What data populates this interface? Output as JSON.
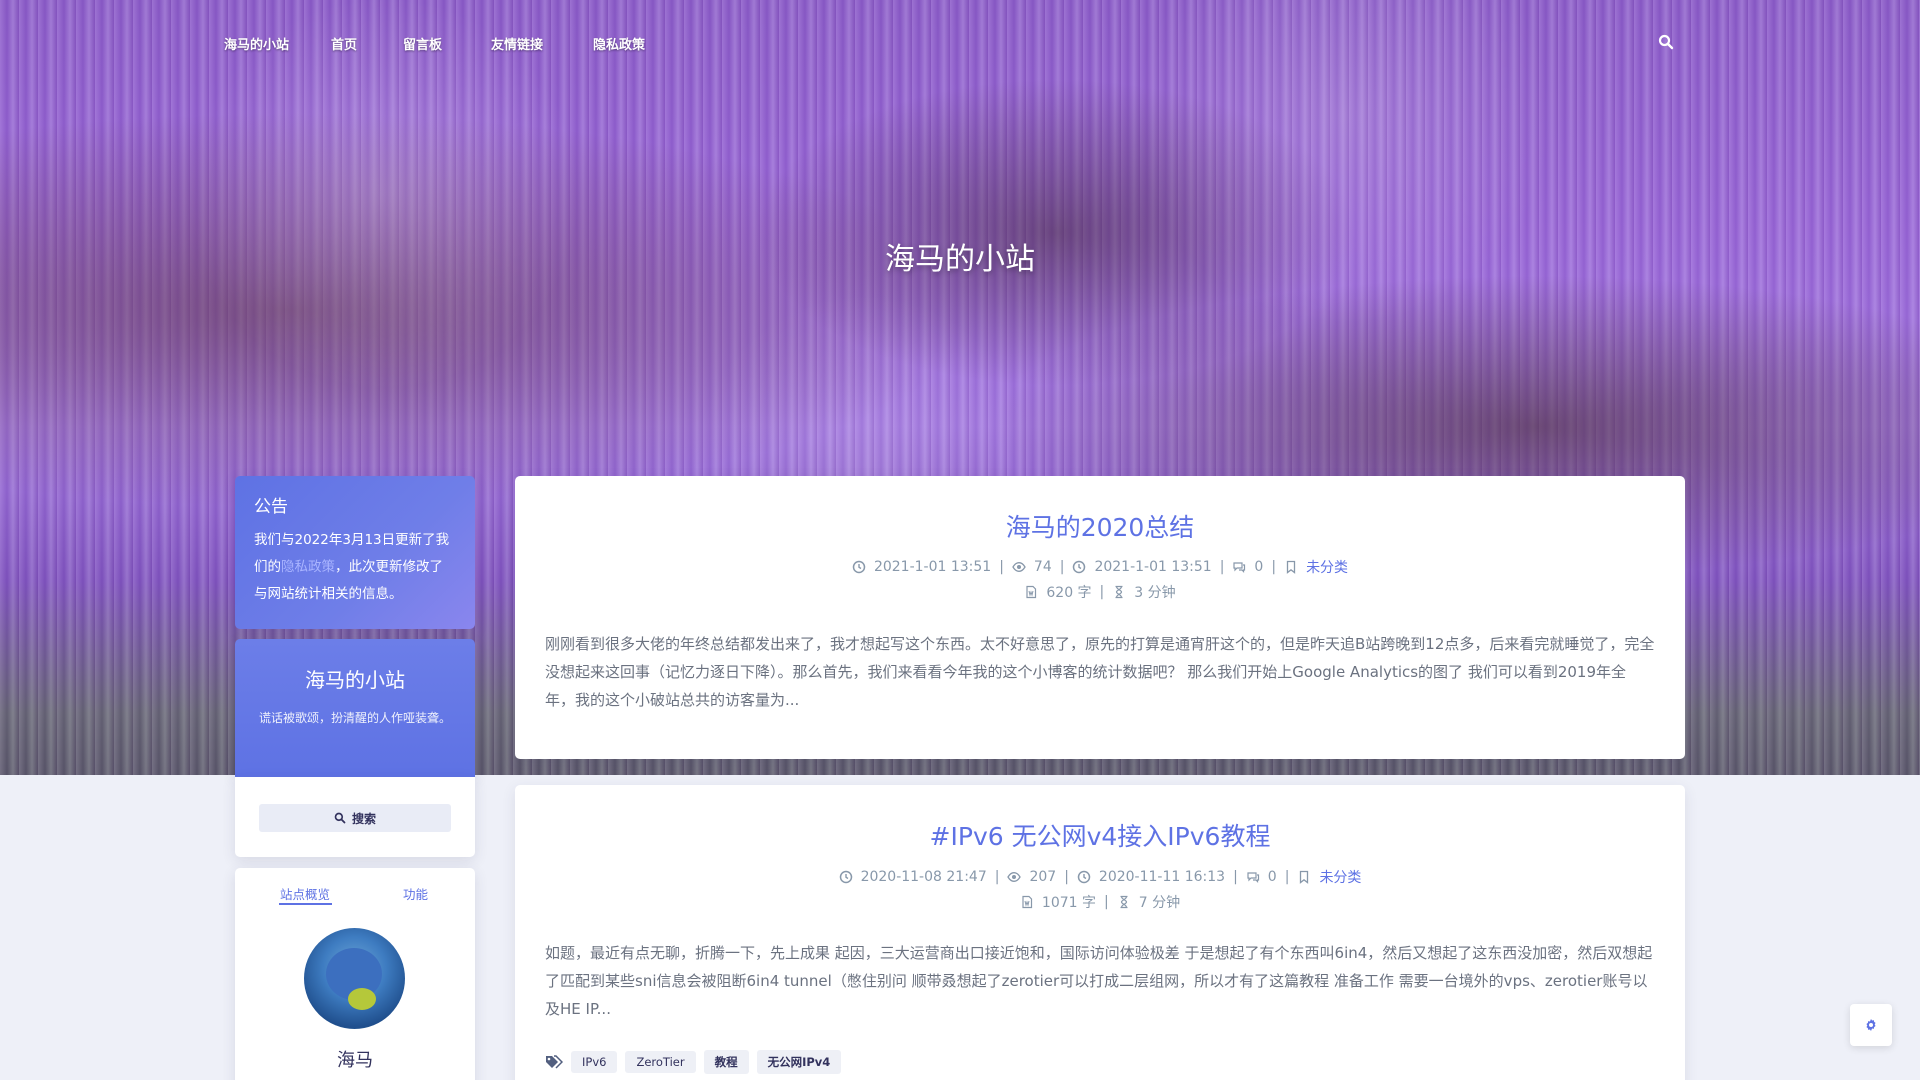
{
  "nav": {
    "brand": "海马的小站",
    "items": [
      {
        "label": "首页"
      },
      {
        "label": "留言板"
      },
      {
        "label": "友情链接"
      },
      {
        "label": "隐私政策"
      }
    ],
    "search_icon": "search-icon"
  },
  "hero": {
    "title": "海马的小站"
  },
  "sidebar": {
    "notice": {
      "title": "公告",
      "text_before": "我们与2022年3月13日更新了我们的",
      "link": "隐私政策",
      "text_after": "，此次更新修改了与网站统计相关的信息。"
    },
    "site": {
      "title": "海马的小站",
      "subtitle": "谎话被歌颂，扮清醒的人作哑装聋。"
    },
    "search": {
      "label": "搜索",
      "icon": "search-icon"
    },
    "overview": {
      "tabs": [
        {
          "label": "站点概览"
        },
        {
          "label": "功能"
        }
      ],
      "author_name": "海马"
    }
  },
  "posts": [
    {
      "title": "海马的2020总结",
      "published": "2021-1-01 13:51",
      "views": "74",
      "updated": "2021-1-01 13:51",
      "comments": "0",
      "category": "未分类",
      "words": "620 字",
      "read_time": "3 分钟",
      "excerpt": "刚刚看到很多大佬的年终总结都发出来了，我才想起写这个东西。太不好意思了，原先的打算是通宵肝这个的，但是昨天追B站跨晚到12点多，后来看完就睡觉了，完全没想起来这回事（记忆力逐日下降）。那么首先，我们来看看今年我的这个小博客的统计数据吧？ 那么我们开始上Google Analytics的图了 我们可以看到2019年全年，我的这个小破站总共的访客量为..."
    },
    {
      "title": "#IPv6 无公网v4接入IPv6教程",
      "published": "2020-11-08 21:47",
      "views": "207",
      "updated": "2020-11-11 16:13",
      "comments": "0",
      "category": "未分类",
      "words": "1071 字",
      "read_time": "7 分钟",
      "excerpt": "如题，最近有点无聊，折腾一下，先上成果 起因，三大运营商出口接近饱和，国际访问体验极差 于是想起了有个东西叫6in4，然后又想起了这东西没加密，然后双想起了匹配到某些sni信息会被阻断6in4 tunnel（憋住别问 顺带叒想起了zerotier可以打成二层组网，所以才有了这篇教程 准备工作 需要一台境外的vps、zerotier账号以及HE IP...",
      "tags": [
        "IPv6",
        "ZeroTier",
        "教程",
        "无公网IPv4"
      ]
    }
  ],
  "float_button": {
    "icon": "gear-icon"
  },
  "colors": {
    "accent": "#5e72e4",
    "page_bg": "#eef0f8"
  }
}
